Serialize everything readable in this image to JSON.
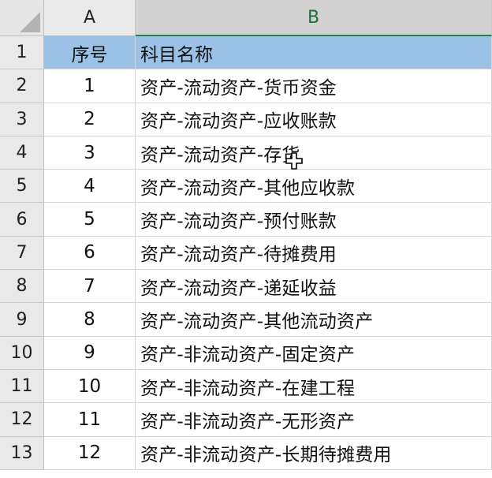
{
  "columns": {
    "a": "A",
    "b": "B"
  },
  "header_row": {
    "row_num": "1",
    "a": "序号",
    "b": "科目名称"
  },
  "rows": [
    {
      "row_num": "2",
      "seq": "1",
      "name": "资产-流动资产-货币资金"
    },
    {
      "row_num": "3",
      "seq": "2",
      "name": "资产-流动资产-应收账款"
    },
    {
      "row_num": "4",
      "seq": "3",
      "name": "资产-流动资产-存货"
    },
    {
      "row_num": "5",
      "seq": "4",
      "name": "资产-流动资产-其他应收款"
    },
    {
      "row_num": "6",
      "seq": "5",
      "name": "资产-流动资产-预付账款"
    },
    {
      "row_num": "7",
      "seq": "6",
      "name": "资产-流动资产-待摊费用"
    },
    {
      "row_num": "8",
      "seq": "7",
      "name": "资产-流动资产-递延收益"
    },
    {
      "row_num": "9",
      "seq": "8",
      "name": "资产-流动资产-其他流动资产"
    },
    {
      "row_num": "10",
      "seq": "9",
      "name": "资产-非流动资产-固定资产"
    },
    {
      "row_num": "11",
      "seq": "10",
      "name": "资产-非流动资产-在建工程"
    },
    {
      "row_num": "12",
      "seq": "11",
      "name": "资产-非流动资产-无形资产"
    },
    {
      "row_num": "13",
      "seq": "12",
      "name": "资产-非流动资产-长期待摊费用"
    }
  ],
  "colors": {
    "header_fill": "#9bc2e6",
    "selected_column_text": "#1f6e3a"
  },
  "icons": {
    "pointer": "cell-select-cross-icon"
  }
}
